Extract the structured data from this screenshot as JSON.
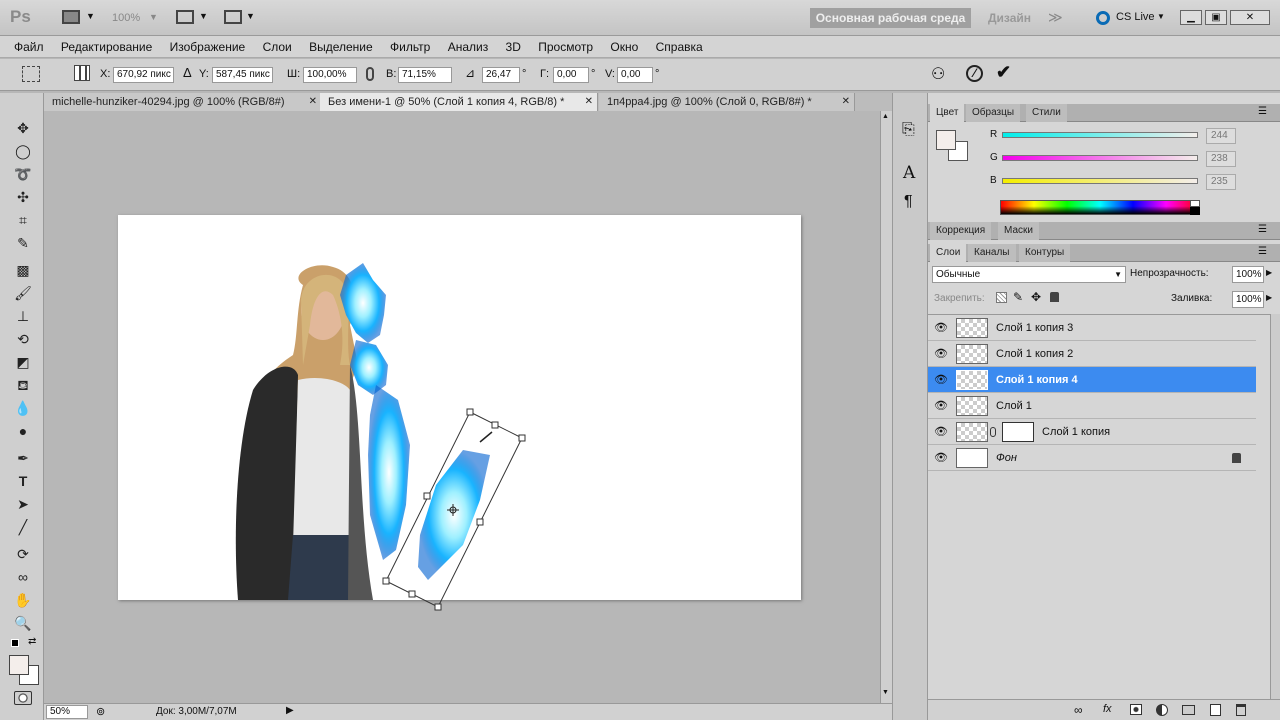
{
  "app": {
    "logo": "Ps",
    "zoom_value": "100%",
    "workspace_active": "Основная рабочая среда",
    "workspace_alt": "Дизайн",
    "workspace_more": "≫",
    "cs_live": "CS Live"
  },
  "menu": [
    "Файл",
    "Редактирование",
    "Изображение",
    "Слои",
    "Выделение",
    "Фильтр",
    "Анализ",
    "3D",
    "Просмотр",
    "Окно",
    "Справка"
  ],
  "options": {
    "x_label": "X:",
    "x_value": "670,92 пикс",
    "y_label": "Y:",
    "y_value": "587,45 пикс",
    "w_label": "Ш:",
    "w_value": "100,00%",
    "h_label": "В:",
    "h_value": "71,15%",
    "angle_value": "26,47",
    "hskew_label": "Г:",
    "hskew_value": "0,00",
    "vskew_label": "V:",
    "vskew_value": "0,00",
    "degree": "°"
  },
  "tabs": [
    {
      "label": "michelle-hunziker-40294.jpg @ 100% (RGB/8#)",
      "close": "✕"
    },
    {
      "label": "Без имени-1 @ 50% (Слой 1 копия 4, RGB/8) *",
      "close": "✕"
    },
    {
      "label": "1п4рра4.jpg @ 100% (Слой 0, RGB/8#) *",
      "close": "✕"
    }
  ],
  "status": {
    "zoom": "50%",
    "doc": "Док: 3,00М/7,07М"
  },
  "color_panel": {
    "tabs": [
      "Цвет",
      "Образцы",
      "Стили"
    ],
    "r_label": "R",
    "r_value": "244",
    "g_label": "G",
    "g_value": "238",
    "b_label": "B",
    "b_value": "235"
  },
  "adjust_panel": {
    "tabs": [
      "Коррекция",
      "Маски"
    ]
  },
  "layers_panel": {
    "tabs": [
      "Слои",
      "Каналы",
      "Контуры"
    ],
    "blend_mode": "Обычные",
    "opacity_label": "Непрозрачность:",
    "opacity_value": "100%",
    "lock_label": "Закрепить:",
    "fill_label": "Заливка:",
    "fill_value": "100%",
    "layers": [
      {
        "name": "Слой 1 копия 3"
      },
      {
        "name": "Слой 1 копия 2"
      },
      {
        "name": "Слой 1 копия 4"
      },
      {
        "name": "Слой 1"
      },
      {
        "name": "Слой 1 копия"
      },
      {
        "name": "Фон"
      }
    ]
  },
  "colors": {
    "accent_selected_layer": "#3c8bf0",
    "glow": "#19b4ff"
  }
}
